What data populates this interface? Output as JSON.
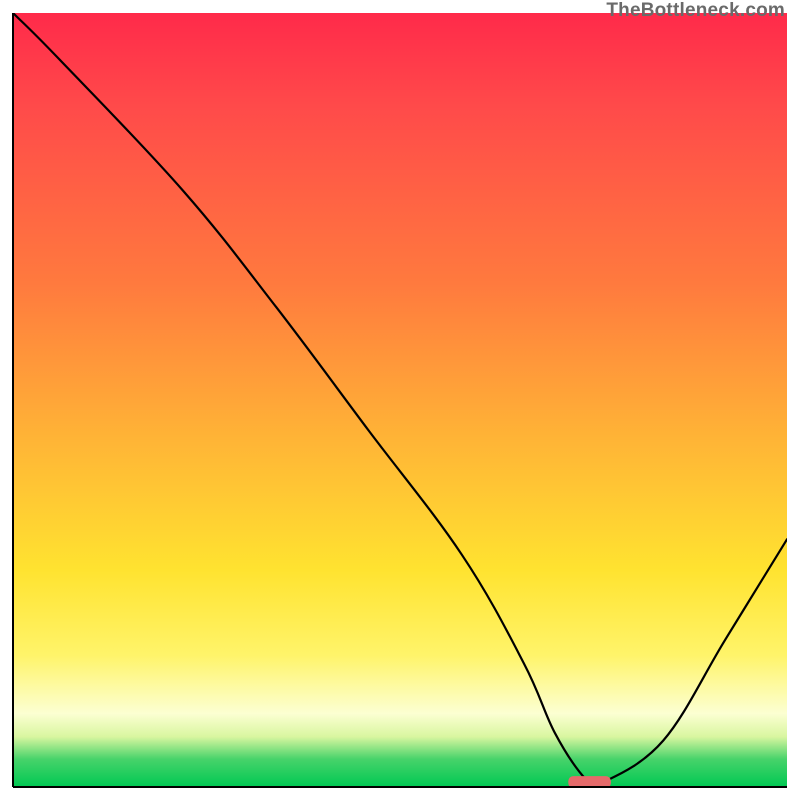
{
  "watermark": "TheBottleneck.com",
  "chart_data": {
    "type": "line",
    "title": "",
    "xlabel": "",
    "ylabel": "",
    "xlim": [
      0,
      100
    ],
    "ylim": [
      0,
      100
    ],
    "grid": false,
    "legend": false,
    "series": [
      {
        "name": "bottleneck-curve",
        "x": [
          0,
          6,
          22,
          34,
          46,
          58,
          66,
          70,
          74,
          76,
          84,
          92,
          100
        ],
        "y": [
          100,
          94,
          77,
          62,
          46,
          30,
          16,
          7,
          1,
          0.5,
          6,
          19,
          32
        ]
      }
    ],
    "marker": {
      "name": "optimal-marker",
      "x_center": 74.5,
      "y": 0.5,
      "width_pct": 5.5,
      "color": "#e46a6a"
    },
    "background_gradient_stops": [
      {
        "pos": 0.0,
        "color": "#ff2a4a"
      },
      {
        "pos": 0.12,
        "color": "#ff4a4a"
      },
      {
        "pos": 0.35,
        "color": "#ff7a3e"
      },
      {
        "pos": 0.55,
        "color": "#ffb436"
      },
      {
        "pos": 0.72,
        "color": "#ffe330"
      },
      {
        "pos": 0.83,
        "color": "#fff46a"
      },
      {
        "pos": 0.905,
        "color": "#fcffd2"
      },
      {
        "pos": 0.935,
        "color": "#d9f6a0"
      },
      {
        "pos": 0.964,
        "color": "#47d36a"
      },
      {
        "pos": 1.0,
        "color": "#00c853"
      }
    ]
  }
}
